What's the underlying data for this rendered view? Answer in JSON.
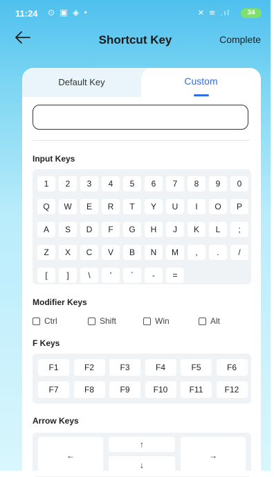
{
  "status_bar": {
    "time": "11:24",
    "left_icons": "⊙ ▣ ◈ •",
    "right_icons": "✕ ≋ .ıl",
    "battery": "34"
  },
  "header": {
    "title": "Shortcut Key",
    "complete_label": "Complete"
  },
  "tabs": {
    "default_label": "Default Key",
    "custom_label": "Custom",
    "active": "Custom"
  },
  "key_input": {
    "value": "",
    "placeholder": ""
  },
  "input_keys": {
    "title": "Input Keys",
    "rows": [
      [
        "1",
        "2",
        "3",
        "4",
        "5",
        "6",
        "7",
        "8",
        "9",
        "0"
      ],
      [
        "Q",
        "W",
        "E",
        "R",
        "T",
        "Y",
        "U",
        "I",
        "O",
        "P"
      ],
      [
        "A",
        "S",
        "D",
        "F",
        "G",
        "H",
        "J",
        "K",
        "L",
        ";"
      ],
      [
        "Z",
        "X",
        "C",
        "V",
        "B",
        "N",
        "M",
        ",",
        ".",
        "/"
      ],
      [
        "[",
        "]",
        "\\",
        "'",
        "`",
        "-",
        "="
      ]
    ]
  },
  "modifier_keys": {
    "title": "Modifier Keys",
    "items": [
      {
        "label": "Ctrl",
        "checked": false
      },
      {
        "label": "Shift",
        "checked": false
      },
      {
        "label": "Win",
        "checked": false
      },
      {
        "label": "Alt",
        "checked": false
      }
    ]
  },
  "f_keys": {
    "title": "F Keys",
    "rows": [
      [
        "F1",
        "F2",
        "F3",
        "F4",
        "F5",
        "F6"
      ],
      [
        "F7",
        "F8",
        "F9",
        "F10",
        "F11",
        "F12"
      ]
    ]
  },
  "arrow_keys": {
    "title": "Arrow Keys",
    "left": "←",
    "up": "↑",
    "down": "↓",
    "right": "→"
  },
  "colors": {
    "accent": "#2e6fe7",
    "header_gradient_top": "#4ec0ee",
    "panel_bg": "#f0f3f6",
    "battery": "#7fe06b"
  }
}
